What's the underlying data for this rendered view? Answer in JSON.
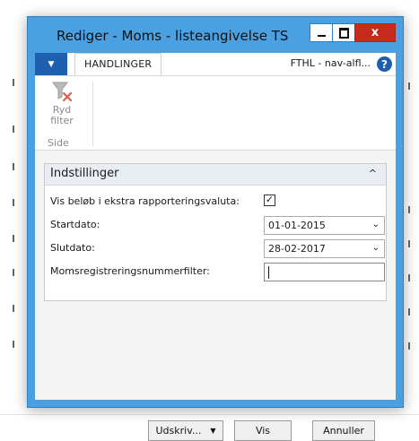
{
  "window": {
    "title": "Rediger - Moms - listeangivelse TS",
    "close_glyph": "x"
  },
  "ribbon": {
    "tab_label": "HANDLINGER",
    "company": "FTHL - nav-alfl...",
    "help_glyph": "?",
    "clear_filter_label_1": "Ryd",
    "clear_filter_label_2": "filter",
    "group_label": "Side"
  },
  "options": {
    "section_title": "Indstillinger",
    "collapse_glyph": "^",
    "extra_currency_label": "Vis beløb i ekstra rapporteringsvaluta:",
    "extra_currency_checked": true,
    "check_glyph": "✓",
    "start_date_label": "Startdato:",
    "start_date_value": "01-01-2015",
    "end_date_label": "Slutdato:",
    "end_date_value": "28-02-2017",
    "vat_filter_label": "Momsregistreringsnummerfilter:",
    "vat_filter_value": "",
    "dropdown_glyph": "⌄"
  },
  "buttons": {
    "print_label": "Udskriv...",
    "print_dropdown_glyph": "▼",
    "show_label": "Vis",
    "cancel_label": "Annuller"
  }
}
